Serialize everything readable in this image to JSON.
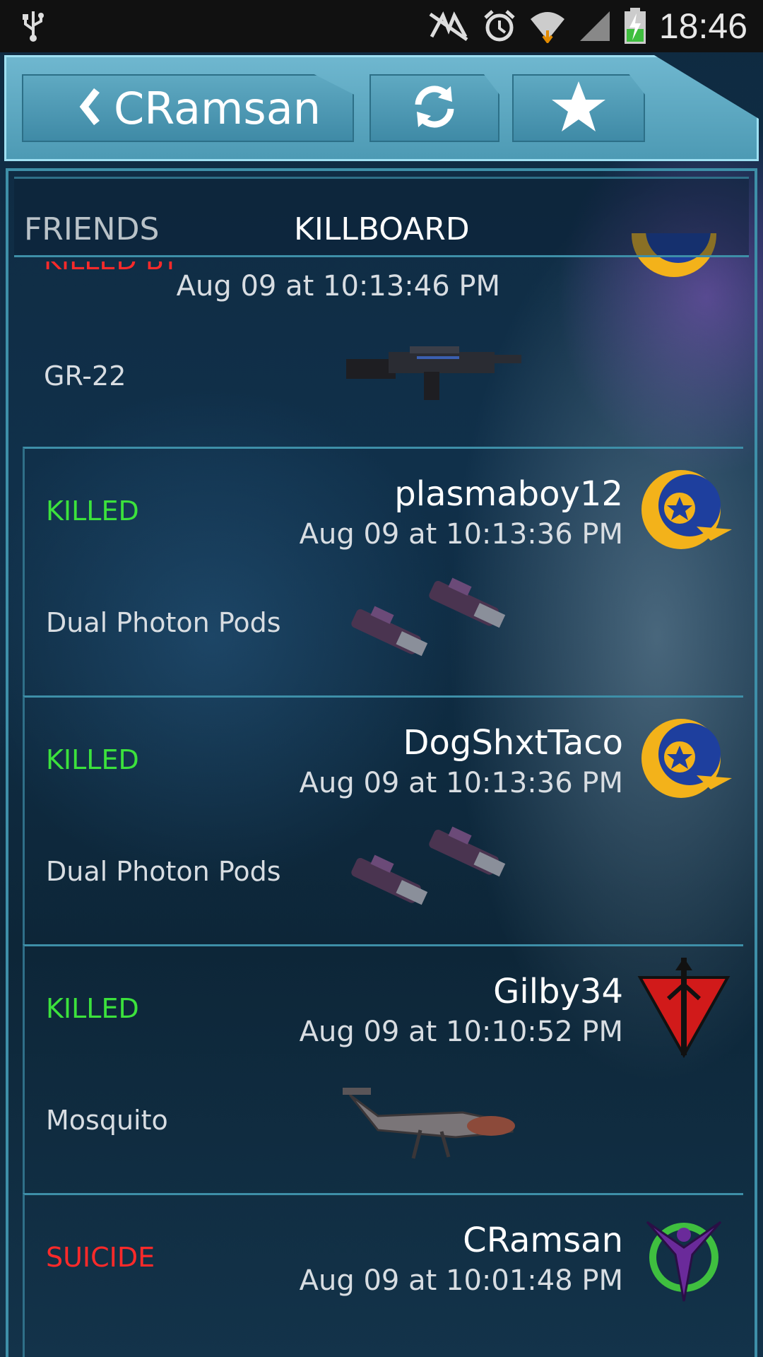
{
  "status_bar": {
    "time": "18:46",
    "icons": [
      "usb-icon",
      "no-nfc-icon",
      "alarm-icon",
      "wifi-icon",
      "signal-icon",
      "battery-charging-icon"
    ]
  },
  "action_bar": {
    "title": "CRamsan",
    "back_icon": "chevron-left-icon",
    "refresh_icon": "refresh-icon",
    "favorite_icon": "star-icon"
  },
  "tabs": [
    {
      "label": "FRIENDS",
      "selected": false
    },
    {
      "label": "KILLBOARD",
      "selected": true
    }
  ],
  "killboard": {
    "partial_top": {
      "status": "KILLED BY",
      "timestamp": "Aug 09 at 10:13:46 PM",
      "weapon": "GR-22"
    },
    "entries": [
      {
        "status": "KILLED",
        "player": "plasmaboy12",
        "timestamp": "Aug 09 at 10:13:36 PM",
        "weapon": "Dual Photon Pods",
        "emblem": "terran-republic-emblem"
      },
      {
        "status": "KILLED",
        "player": "DogShxtTaco",
        "timestamp": "Aug 09 at 10:13:36 PM",
        "weapon": "Dual Photon Pods",
        "emblem": "terran-republic-emblem"
      },
      {
        "status": "KILLED",
        "player": "Gilby34",
        "timestamp": "Aug 09 at 10:10:52 PM",
        "weapon": "Mosquito",
        "emblem": "terran-red-emblem"
      },
      {
        "status": "SUICIDE",
        "player": "CRamsan",
        "timestamp": "Aug 09 at 10:01:48 PM",
        "weapon": "",
        "emblem": "vanu-sovereignty-emblem"
      }
    ]
  },
  "colors": {
    "killed": "#3ce23c",
    "suicide": "#ff2a2a",
    "accent": "#4d9ab4"
  }
}
